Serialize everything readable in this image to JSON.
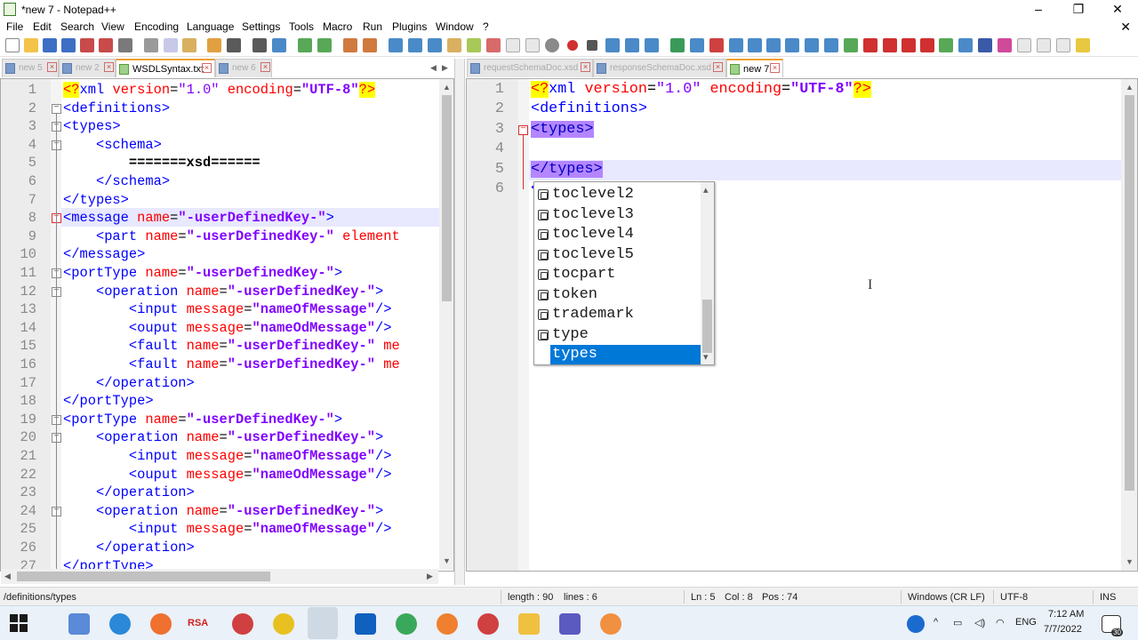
{
  "window": {
    "title": "*new 7 - Notepad++",
    "controls": {
      "minimize": "–",
      "maximize": "❐",
      "close": "✕"
    }
  },
  "menu": [
    "File",
    "Edit",
    "Search",
    "View",
    "Encoding",
    "Language",
    "Settings",
    "Tools",
    "Macro",
    "Run",
    "Plugins",
    "Window",
    "?"
  ],
  "menu_close": "✕",
  "left_tabs": [
    {
      "label": "new 5",
      "state": "inactive"
    },
    {
      "label": "new 2",
      "state": "inactive"
    },
    {
      "label": "WSDLSyntax.txt",
      "state": "active"
    },
    {
      "label": "new 6",
      "state": "inactive"
    }
  ],
  "right_tabs": [
    {
      "label": "requestSchemaDoc.xsd",
      "state": "inactive"
    },
    {
      "label": "responseSchemaDoc.xsd",
      "state": "inactive"
    },
    {
      "label": "new 7",
      "state": "active"
    }
  ],
  "tab_scroll": {
    "left": "◀",
    "right": "▶"
  },
  "left_editor": {
    "line_numbers": [
      "1",
      "2",
      "3",
      "4",
      "5",
      "6",
      "7",
      "8",
      "9",
      "10",
      "11",
      "12",
      "13",
      "14",
      "15",
      "16",
      "17",
      "18",
      "19",
      "20",
      "21",
      "22",
      "23",
      "24",
      "25",
      "26",
      "27"
    ],
    "current_line": 8
  },
  "right_editor": {
    "line_numbers": [
      "1",
      "2",
      "3",
      "4",
      "5",
      "6"
    ],
    "current_line": 5
  },
  "autocomplete": {
    "items": [
      "toclevel2",
      "toclevel3",
      "toclevel4",
      "toclevel5",
      "tocpart",
      "token",
      "trademark",
      "type",
      "types"
    ],
    "selected": "types",
    "arrow_up": "▴",
    "arrow_down": "▾"
  },
  "status": {
    "path": "/definitions/types",
    "length": "length : 90",
    "lines": "lines : 6",
    "ln": "Ln : 5",
    "col": "Col : 8",
    "pos": "Pos : 74",
    "eol": "Windows (CR LF)",
    "encoding": "UTF-8",
    "mode": "INS"
  },
  "taskbar": {
    "time": "7:12 AM",
    "date": "7/7/2022",
    "lang": "ENG",
    "notif_count": "30",
    "pinned_label_rsa": "RSA"
  },
  "icon_names": [
    "start-icon",
    "calculator-icon",
    "edge-icon",
    "avast-icon",
    "rsa-icon",
    "snipping-icon",
    "norton-icon",
    "notepadpp-icon",
    "outlook-icon",
    "chrome-icon",
    "firefox-icon",
    "firefox-dev-icon",
    "file-explorer-icon",
    "teams-icon",
    "postman-icon"
  ],
  "colors": {
    "xml_tag": "#0000ff",
    "xml_attr": "#ff0000",
    "xml_value": "#8000ff",
    "selection": "#0078d7",
    "tag_highlight": "#b486ff",
    "tab_active_accent": "#f0a030"
  }
}
